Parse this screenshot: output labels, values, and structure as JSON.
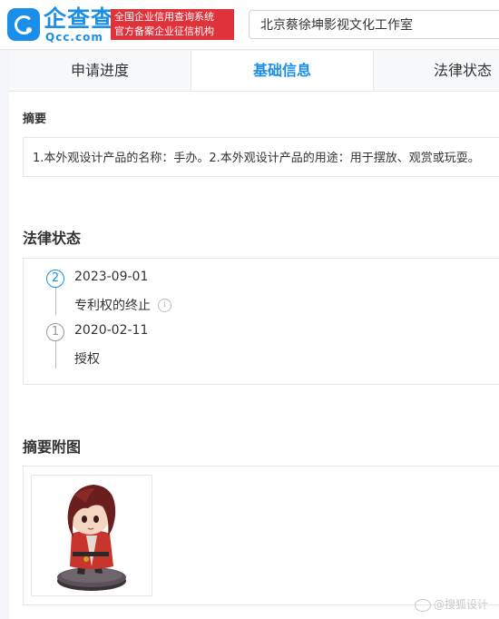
{
  "header": {
    "logo_cn": "企查查",
    "logo_en": "Qcc.com",
    "banner_line1": "全国企业信用查询系统",
    "banner_line2": "官方备案企业征信机构",
    "search_value": "北京蔡徐坤影视文化工作室"
  },
  "tabs": [
    "申请进度",
    "基础信息",
    "法律状态"
  ],
  "abstract": {
    "title": "摘要",
    "text": "1.本外观设计产品的名称：手办。2.本外观设计产品的用途：用于摆放、观赏或玩耍。"
  },
  "legal": {
    "title": "法律状态",
    "events": [
      {
        "num": "2",
        "date": "2023-09-01",
        "status": "专利权的终止"
      },
      {
        "num": "1",
        "date": "2020-02-11",
        "status": "授权"
      }
    ]
  },
  "figure": {
    "title": "摘要附图"
  },
  "watermark": "@搜狐设计",
  "colors": {
    "accent": "#1a8ee8",
    "banner": "#e0323b"
  }
}
